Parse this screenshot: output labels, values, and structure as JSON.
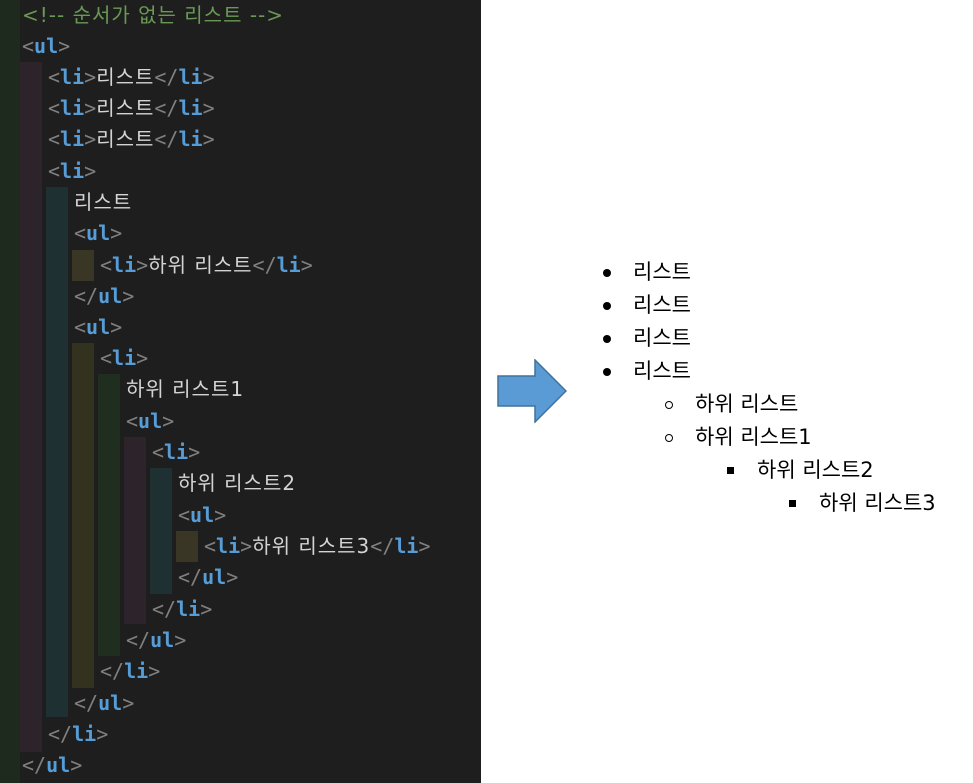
{
  "editor": {
    "lines": [
      [
        {
          "k": "c",
          "v": "<!-- 순서가 없는 리스트 -->"
        }
      ],
      [
        {
          "k": "b",
          "v": "<"
        },
        {
          "k": "t",
          "v": "ul"
        },
        {
          "k": "b",
          "v": ">"
        }
      ],
      [
        {
          "k": "b",
          "v": "<"
        },
        {
          "k": "t",
          "v": "li"
        },
        {
          "k": "b",
          "v": ">"
        },
        {
          "k": "x",
          "v": "리스트"
        },
        {
          "k": "b",
          "v": "</"
        },
        {
          "k": "t",
          "v": "li"
        },
        {
          "k": "b",
          "v": ">"
        }
      ],
      [
        {
          "k": "b",
          "v": "<"
        },
        {
          "k": "t",
          "v": "li"
        },
        {
          "k": "b",
          "v": ">"
        },
        {
          "k": "x",
          "v": "리스트"
        },
        {
          "k": "b",
          "v": "</"
        },
        {
          "k": "t",
          "v": "li"
        },
        {
          "k": "b",
          "v": ">"
        }
      ],
      [
        {
          "k": "b",
          "v": "<"
        },
        {
          "k": "t",
          "v": "li"
        },
        {
          "k": "b",
          "v": ">"
        },
        {
          "k": "x",
          "v": "리스트"
        },
        {
          "k": "b",
          "v": "</"
        },
        {
          "k": "t",
          "v": "li"
        },
        {
          "k": "b",
          "v": ">"
        }
      ],
      [
        {
          "k": "b",
          "v": "<"
        },
        {
          "k": "t",
          "v": "li"
        },
        {
          "k": "b",
          "v": ">"
        }
      ],
      [
        {
          "k": "x",
          "v": "리스트"
        }
      ],
      [
        {
          "k": "b",
          "v": "<"
        },
        {
          "k": "t",
          "v": "ul"
        },
        {
          "k": "b",
          "v": ">"
        }
      ],
      [
        {
          "k": "b",
          "v": "<"
        },
        {
          "k": "t",
          "v": "li"
        },
        {
          "k": "b",
          "v": ">"
        },
        {
          "k": "x",
          "v": "하위 리스트"
        },
        {
          "k": "b",
          "v": "</"
        },
        {
          "k": "t",
          "v": "li"
        },
        {
          "k": "b",
          "v": ">"
        }
      ],
      [
        {
          "k": "b",
          "v": "</"
        },
        {
          "k": "t",
          "v": "ul"
        },
        {
          "k": "b",
          "v": ">"
        }
      ],
      [
        {
          "k": "b",
          "v": "<"
        },
        {
          "k": "t",
          "v": "ul"
        },
        {
          "k": "b",
          "v": ">"
        }
      ],
      [
        {
          "k": "b",
          "v": "<"
        },
        {
          "k": "t",
          "v": "li"
        },
        {
          "k": "b",
          "v": ">"
        }
      ],
      [
        {
          "k": "x",
          "v": "하위 리스트1"
        }
      ],
      [
        {
          "k": "b",
          "v": "<"
        },
        {
          "k": "t",
          "v": "ul"
        },
        {
          "k": "b",
          "v": ">"
        }
      ],
      [
        {
          "k": "b",
          "v": "<"
        },
        {
          "k": "t",
          "v": "li"
        },
        {
          "k": "b",
          "v": ">"
        }
      ],
      [
        {
          "k": "x",
          "v": "하위 리스트2"
        }
      ],
      [
        {
          "k": "b",
          "v": "<"
        },
        {
          "k": "t",
          "v": "ul"
        },
        {
          "k": "b",
          "v": ">"
        }
      ],
      [
        {
          "k": "b",
          "v": "<"
        },
        {
          "k": "t",
          "v": "li"
        },
        {
          "k": "b",
          "v": ">"
        },
        {
          "k": "x",
          "v": "하위 리스트3"
        },
        {
          "k": "b",
          "v": "</"
        },
        {
          "k": "t",
          "v": "li"
        },
        {
          "k": "b",
          "v": ">"
        }
      ],
      [
        {
          "k": "b",
          "v": "</"
        },
        {
          "k": "t",
          "v": "ul"
        },
        {
          "k": "b",
          "v": ">"
        }
      ],
      [
        {
          "k": "b",
          "v": "</"
        },
        {
          "k": "t",
          "v": "li"
        },
        {
          "k": "b",
          "v": ">"
        }
      ],
      [
        {
          "k": "b",
          "v": "</"
        },
        {
          "k": "t",
          "v": "ul"
        },
        {
          "k": "b",
          "v": ">"
        }
      ],
      [
        {
          "k": "b",
          "v": "</"
        },
        {
          "k": "t",
          "v": "li"
        },
        {
          "k": "b",
          "v": ">"
        }
      ],
      [
        {
          "k": "b",
          "v": "</"
        },
        {
          "k": "t",
          "v": "ul"
        },
        {
          "k": "b",
          "v": ">"
        }
      ],
      [
        {
          "k": "b",
          "v": "</"
        },
        {
          "k": "t",
          "v": "li"
        },
        {
          "k": "b",
          "v": ">"
        }
      ],
      [
        {
          "k": "b",
          "v": "</"
        },
        {
          "k": "t",
          "v": "ul"
        },
        {
          "k": "b",
          "v": ">"
        }
      ]
    ]
  },
  "arrow": {
    "color": "#5b9bd5",
    "icon": "right-arrow-icon"
  },
  "preview": {
    "items": [
      {
        "text": "리스트",
        "bullet": "disc"
      },
      {
        "text": "리스트",
        "bullet": "disc"
      },
      {
        "text": "리스트",
        "bullet": "disc"
      },
      {
        "text": "리스트",
        "bullet": "disc"
      },
      {
        "text": "하위 리스트",
        "bullet": "circle"
      },
      {
        "text": "하위 리스트1",
        "bullet": "circle"
      },
      {
        "text": "하위 리스트2",
        "bullet": "square"
      },
      {
        "text": "하위 리스트3",
        "bullet": "square"
      }
    ]
  }
}
